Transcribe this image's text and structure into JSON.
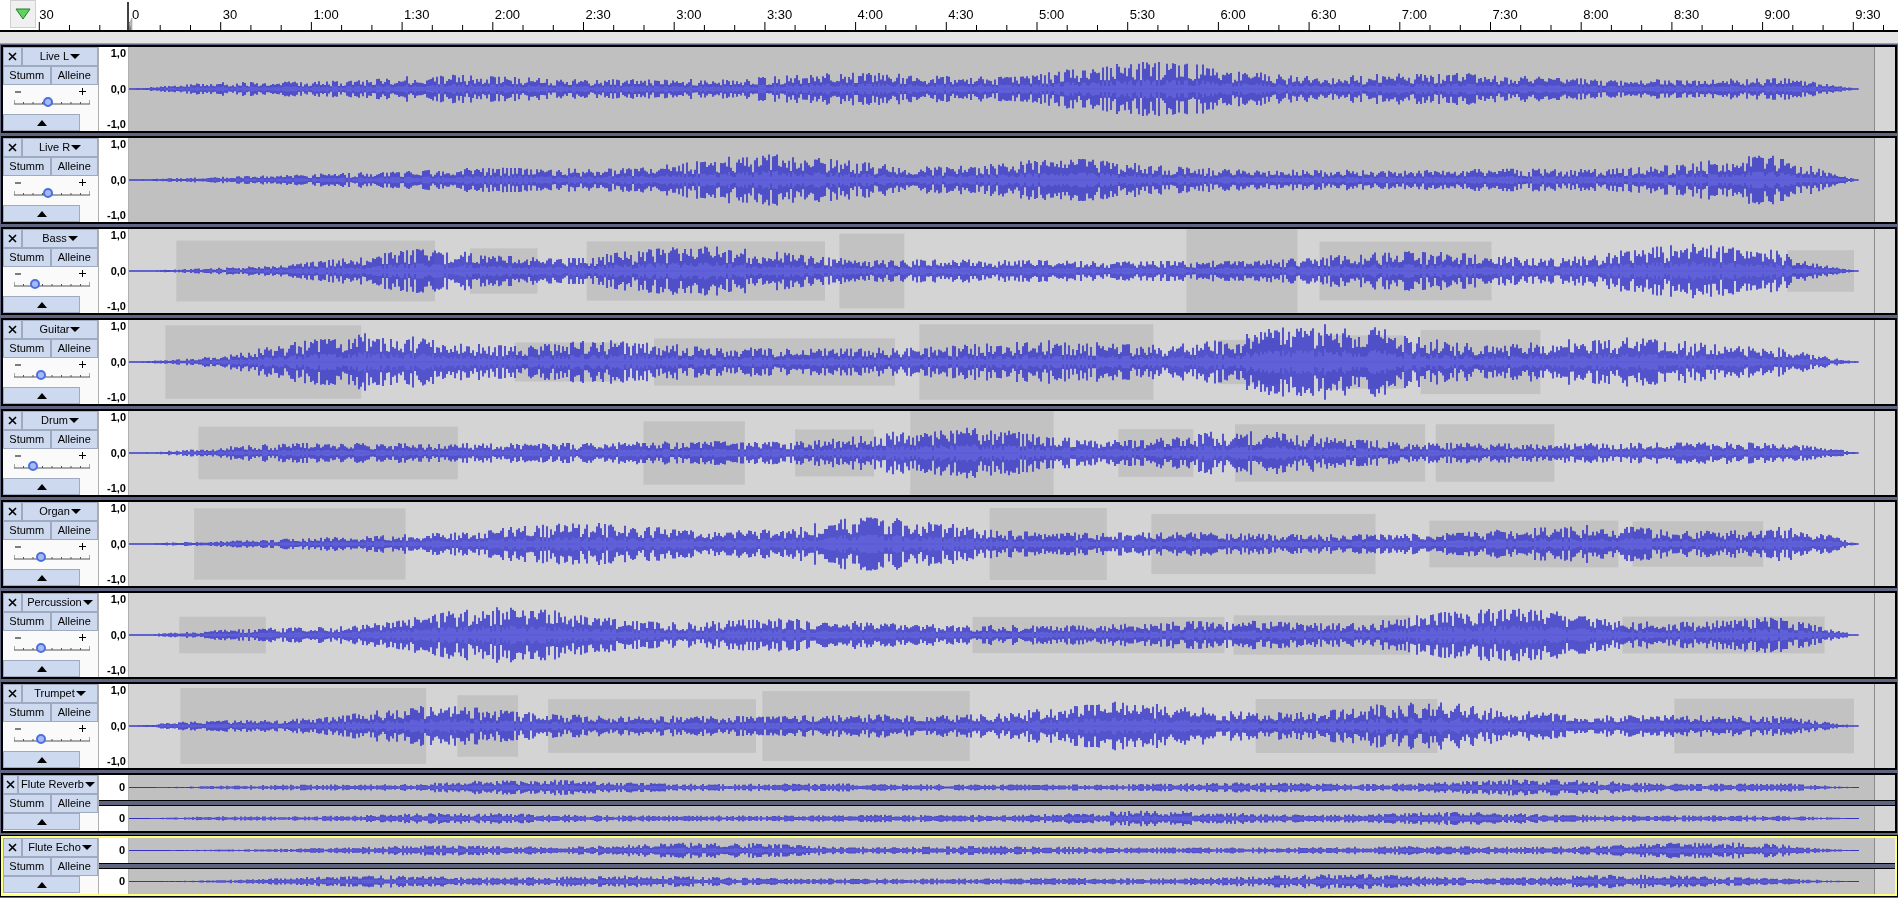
{
  "ruler": {
    "labels": [
      "30",
      "0",
      "30",
      "1:00",
      "1:30",
      "2:00",
      "2:30",
      "3:00",
      "3:30",
      "4:00",
      "4:30",
      "5:00",
      "5:30",
      "6:00",
      "6:30",
      "7:00",
      "7:30",
      "8:00",
      "8:30",
      "9:00",
      "9:30"
    ]
  },
  "tracks": [
    {
      "kind": "mono",
      "name": "Live L",
      "mute": "Stumm",
      "solo": "Alleine",
      "gain": {
        "level": 0.46
      },
      "scale": [
        "1,0",
        "0,0",
        "-1,0"
      ],
      "focused": false
    },
    {
      "kind": "mono",
      "name": "Live R",
      "mute": "Stumm",
      "solo": "Alleine",
      "gain": {
        "level": 0.46
      },
      "scale": [
        "1,0",
        "0,0",
        "-1,0"
      ],
      "focused": false
    },
    {
      "kind": "mono",
      "name": "Bass",
      "mute": "Stumm",
      "solo": "Alleine",
      "gain": {
        "level": 0.29
      },
      "scale": [
        "1,0",
        "0,0",
        "-1,0"
      ],
      "focused": false
    },
    {
      "kind": "mono",
      "name": "Guitar",
      "mute": "Stumm",
      "solo": "Alleine",
      "gain": {
        "level": 0.37
      },
      "scale": [
        "1,0",
        "0,0",
        "-1,0"
      ],
      "focused": false
    },
    {
      "kind": "mono",
      "name": "Drum",
      "mute": "Stumm",
      "solo": "Alleine",
      "gain": {
        "level": 0.26
      },
      "scale": [
        "1,0",
        "0,0",
        "-1,0"
      ],
      "focused": false
    },
    {
      "kind": "mono",
      "name": "Organ",
      "mute": "Stumm",
      "solo": "Alleine",
      "gain": {
        "level": 0.37
      },
      "scale": [
        "1,0",
        "0,0",
        "-1,0"
      ],
      "focused": false
    },
    {
      "kind": "mono",
      "name": "Percussion",
      "mute": "Stumm",
      "solo": "Alleine",
      "gain": {
        "level": 0.37
      },
      "scale": [
        "1,0",
        "0,0",
        "-1,0"
      ],
      "focused": false
    },
    {
      "kind": "mono",
      "name": "Trumpet",
      "mute": "Stumm",
      "solo": "Alleine",
      "gain": {
        "level": 0.37
      },
      "scale": [
        "1,0",
        "0,0",
        "-1,0"
      ],
      "focused": false
    },
    {
      "kind": "stereo",
      "name": "Flute Reverb",
      "mute": "Stumm",
      "solo": "Alleine",
      "channels": [
        {
          "scale": "0"
        },
        {
          "scale": "0"
        }
      ],
      "focused": false
    },
    {
      "kind": "stereo",
      "name": "Flute Echo",
      "mute": "Stumm",
      "solo": "Alleine",
      "channels": [
        {
          "scale": "0"
        },
        {
          "scale": "0"
        }
      ],
      "focused": true
    }
  ]
}
